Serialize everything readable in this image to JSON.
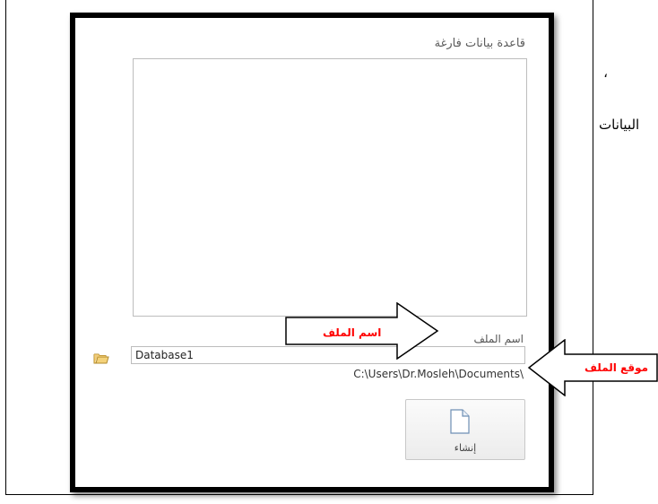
{
  "background_text": [
    "،",
    "البيانات"
  ],
  "panel": {
    "title": "قاعدة بيانات فارغة",
    "filename_label": "اسم الملف",
    "filename_value": "Database1",
    "path": "C:\\Users\\Dr.Mosleh\\Documents\\",
    "create_label": "إنشاء"
  },
  "callouts": {
    "filename": "اسم الملف",
    "location": "موقع الملف"
  },
  "colors": {
    "callout_text": "#ff0000",
    "border": "#000000"
  }
}
